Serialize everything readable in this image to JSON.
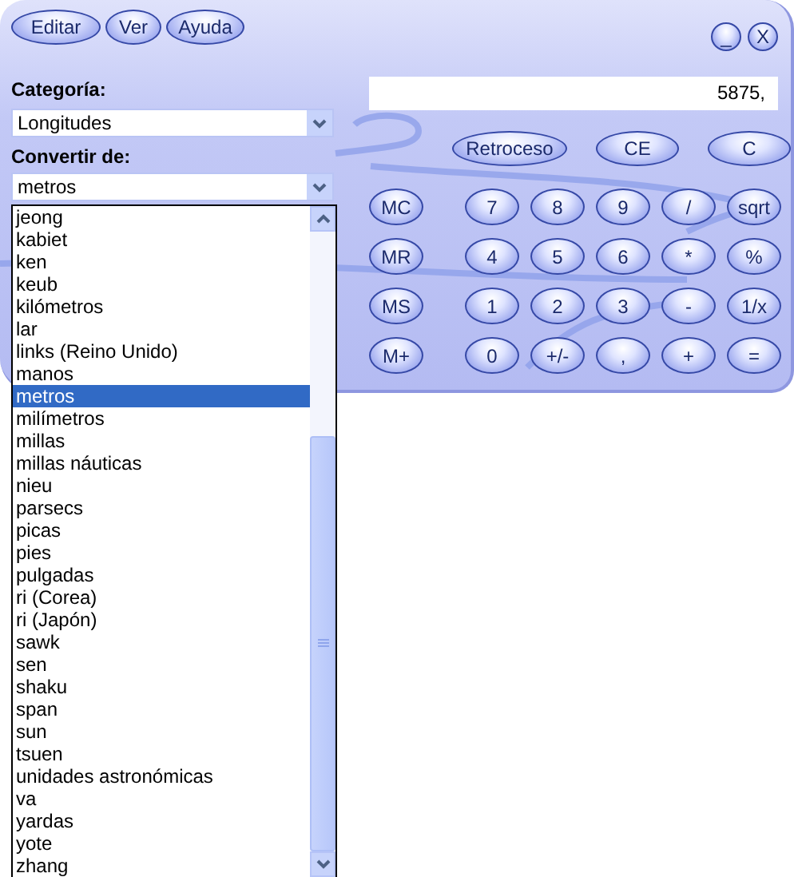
{
  "menu": [
    {
      "label": "Editar"
    },
    {
      "label": "Ver"
    },
    {
      "label": "Ayuda"
    }
  ],
  "window_controls": [
    {
      "label": "_"
    },
    {
      "label": "X"
    }
  ],
  "category": {
    "label": "Categoría:",
    "value": "Longitudes"
  },
  "convert_from": {
    "label": "Convertir de:",
    "value": "metros",
    "expanded": true
  },
  "dropdown_items": [
    {
      "label": "jeong",
      "selected": false
    },
    {
      "label": "kabiet",
      "selected": false
    },
    {
      "label": "ken",
      "selected": false
    },
    {
      "label": "keub",
      "selected": false
    },
    {
      "label": "kilómetros",
      "selected": false
    },
    {
      "label": "lar",
      "selected": false
    },
    {
      "label": "links (Reino Unido)",
      "selected": false
    },
    {
      "label": "manos",
      "selected": false
    },
    {
      "label": "metros",
      "selected": true
    },
    {
      "label": "milímetros",
      "selected": false
    },
    {
      "label": "millas",
      "selected": false
    },
    {
      "label": "millas náuticas",
      "selected": false
    },
    {
      "label": "nieu",
      "selected": false
    },
    {
      "label": "parsecs",
      "selected": false
    },
    {
      "label": "picas",
      "selected": false
    },
    {
      "label": "pies",
      "selected": false
    },
    {
      "label": "pulgadas",
      "selected": false
    },
    {
      "label": "ri (Corea)",
      "selected": false
    },
    {
      "label": "ri (Japón)",
      "selected": false
    },
    {
      "label": "sawk",
      "selected": false
    },
    {
      "label": "sen",
      "selected": false
    },
    {
      "label": "shaku",
      "selected": false
    },
    {
      "label": "span",
      "selected": false
    },
    {
      "label": "sun",
      "selected": false
    },
    {
      "label": "tsuen",
      "selected": false
    },
    {
      "label": "unidades astronómicas",
      "selected": false
    },
    {
      "label": "va",
      "selected": false
    },
    {
      "label": "yardas",
      "selected": false
    },
    {
      "label": "yote",
      "selected": false
    },
    {
      "label": "zhang",
      "selected": false
    }
  ],
  "display": "5875,",
  "edit_buttons": [
    "Retroceso",
    "CE",
    "C"
  ],
  "keypad": [
    [
      "MC",
      "7",
      "8",
      "9",
      "/",
      "sqrt"
    ],
    [
      "MR",
      "4",
      "5",
      "6",
      "*",
      "%"
    ],
    [
      "MS",
      "1",
      "2",
      "3",
      "-",
      "1/x"
    ],
    [
      "M+",
      "0",
      "+/-",
      ",",
      "+",
      "="
    ]
  ]
}
